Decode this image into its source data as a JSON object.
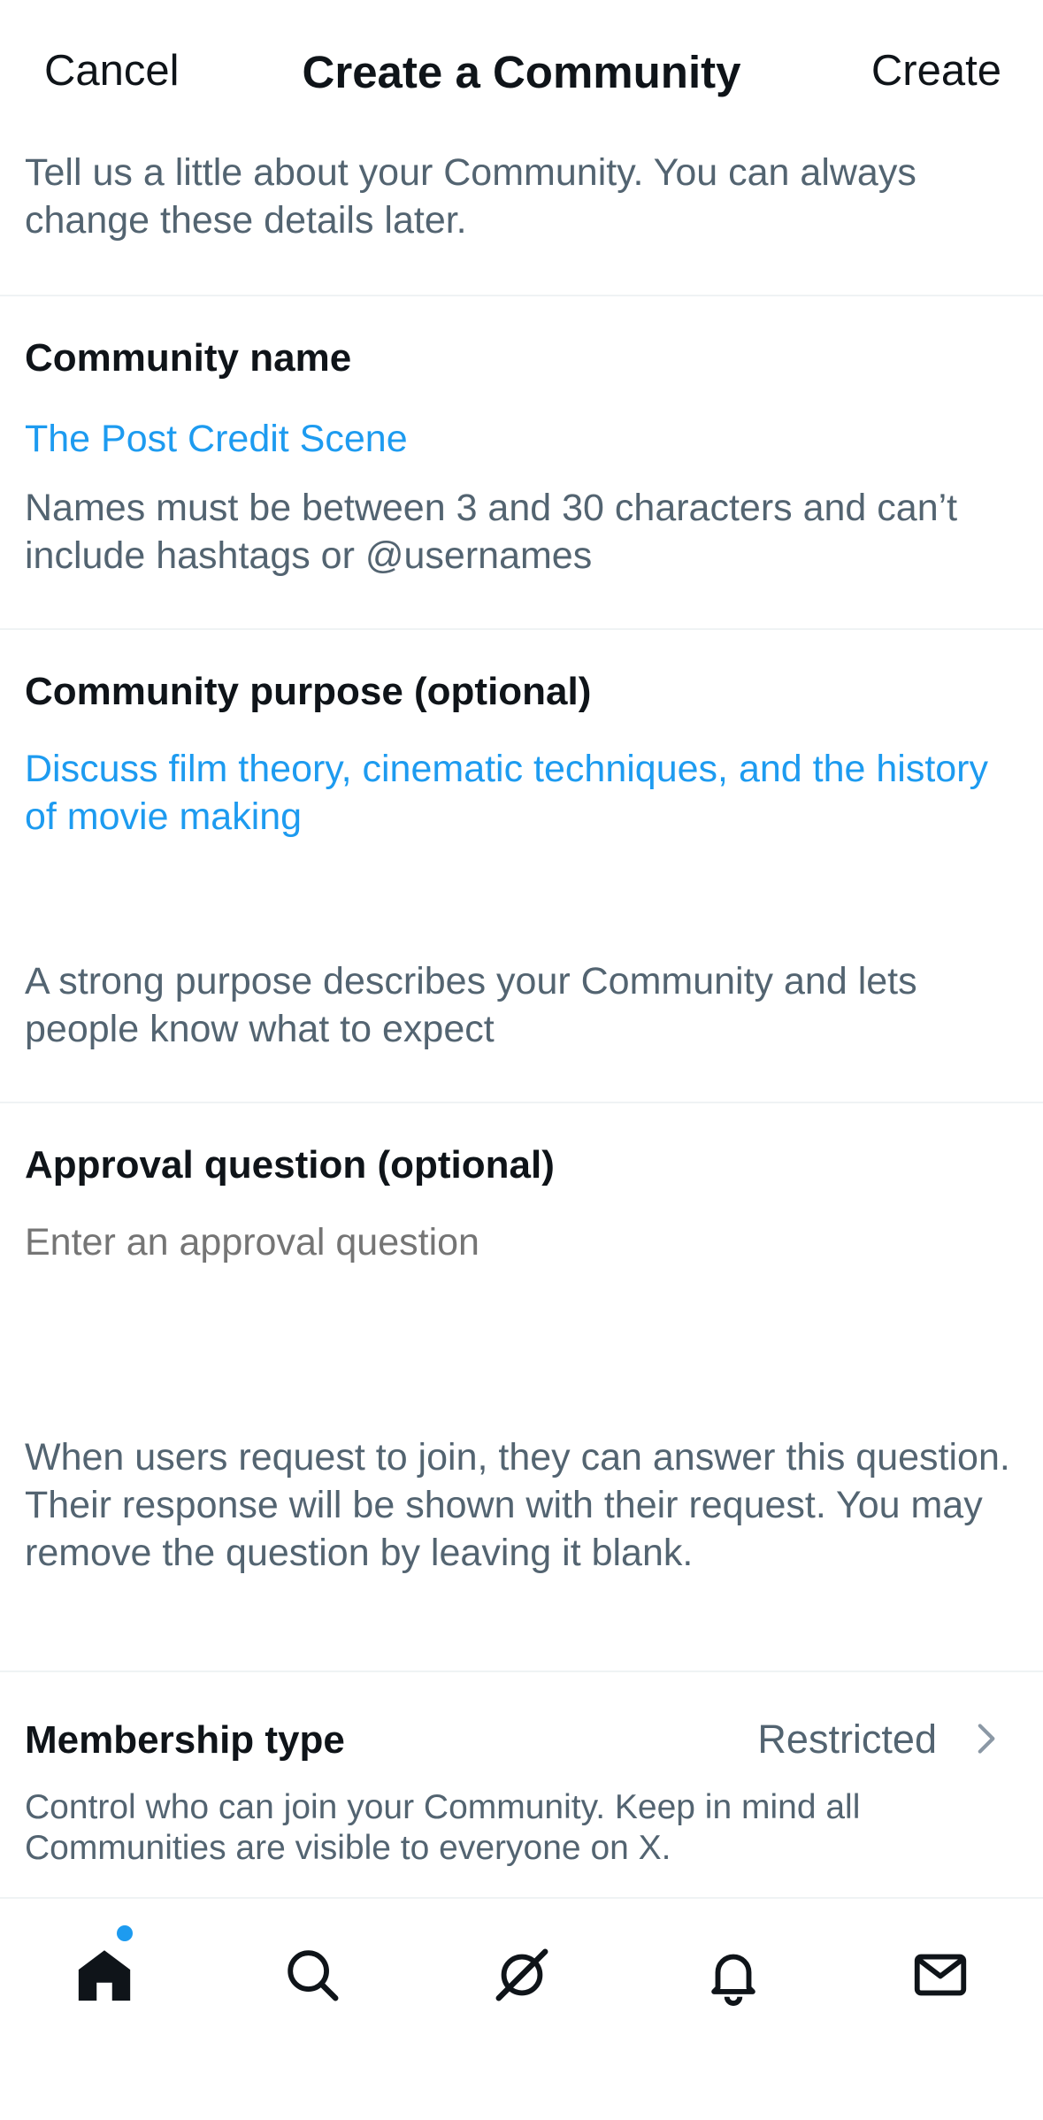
{
  "header": {
    "cancel_label": "Cancel",
    "title": "Create a Community",
    "create_label": "Create"
  },
  "intro": "Tell us a little about your Community. You can always change these details later.",
  "name_section": {
    "label": "Community name",
    "value": "The Post Credit Scene",
    "hint": "Names must be between 3 and 30 characters and can’t include hashtags or @usernames"
  },
  "purpose_section": {
    "label": "Community purpose (optional)",
    "value": "Discuss film theory, cinematic techniques, and the history of movie making",
    "hint": "A strong purpose describes your Community and lets people know what to expect"
  },
  "approval_section": {
    "label": "Approval question (optional)",
    "placeholder": "Enter an approval question",
    "value": "",
    "hint": "When users request to join, they can answer this question. Their response will be shown with their request. You may remove the question by leaving it blank."
  },
  "membership": {
    "label": "Membership type",
    "value": "Restricted",
    "hint": "Control who can join your Community. Keep in mind all Communities are visible to everyone on X."
  },
  "tabbar": {
    "items": [
      {
        "icon": "home-icon",
        "active": true,
        "badge": true
      },
      {
        "icon": "search-icon"
      },
      {
        "icon": "grok-icon"
      },
      {
        "icon": "bell-icon"
      },
      {
        "icon": "mail-icon"
      }
    ]
  },
  "colors": {
    "accent": "#1d9bf0",
    "text_primary": "#0f1419",
    "text_secondary": "#536471",
    "divider": "#eff3f4"
  }
}
